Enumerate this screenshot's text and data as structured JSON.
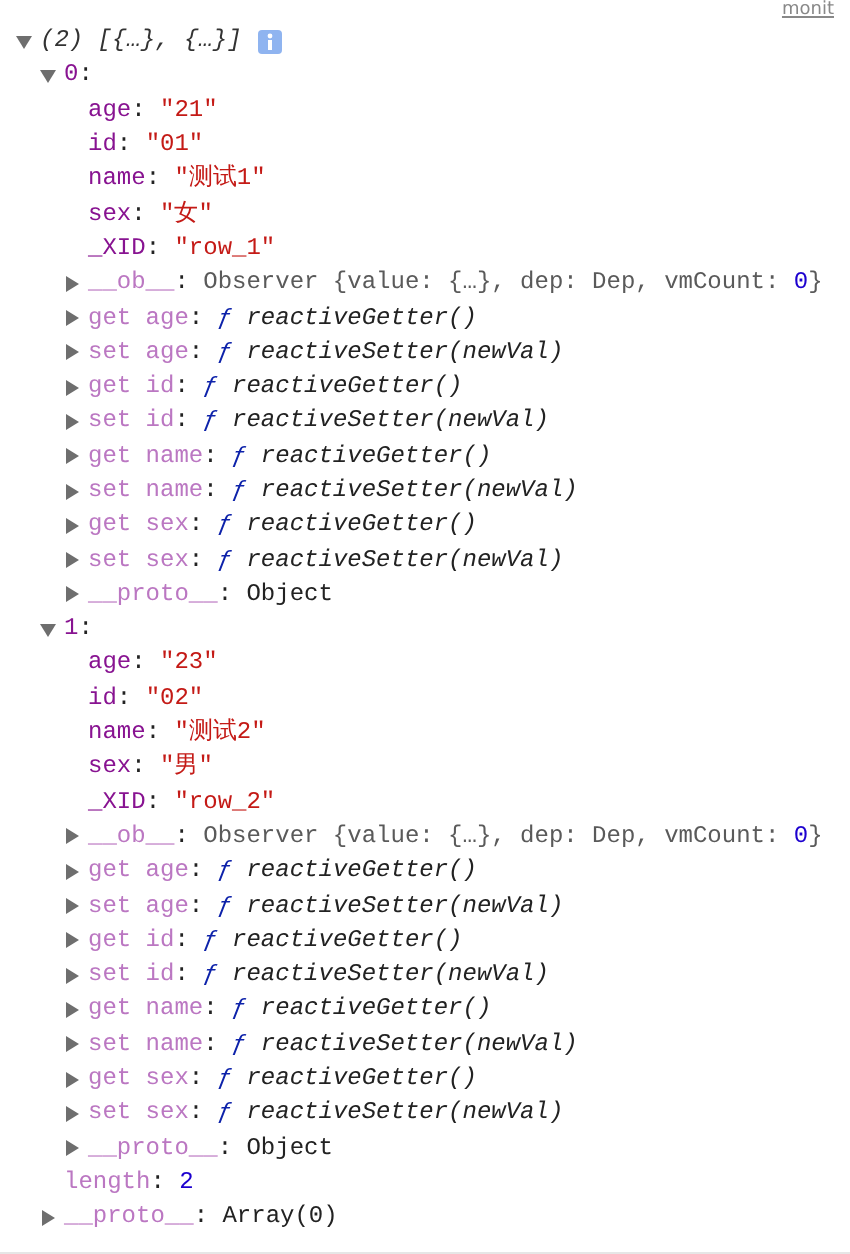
{
  "top_link": "monit",
  "root": {
    "expanded": true,
    "segments": [
      {
        "preview": "(2) [{…}, {…}]"
      }
    ],
    "info_icon": true,
    "children": [
      {
        "expanded": true,
        "segments": [
          {
            "key": "0"
          },
          {
            "plain": ":"
          }
        ],
        "children": [
          {
            "segments": [
              {
                "key": "age"
              },
              {
                "plain": ": "
              },
              {
                "string": "\"21\""
              }
            ]
          },
          {
            "segments": [
              {
                "key": "id"
              },
              {
                "plain": ": "
              },
              {
                "string": "\"01\""
              }
            ]
          },
          {
            "segments": [
              {
                "key": "name"
              },
              {
                "plain": ": "
              },
              {
                "string": "\"测试1\""
              }
            ]
          },
          {
            "segments": [
              {
                "key": "sex"
              },
              {
                "plain": ": "
              },
              {
                "string": "\"女\""
              }
            ]
          },
          {
            "segments": [
              {
                "key": "_XID"
              },
              {
                "plain": ": "
              },
              {
                "string": "\"row_1\""
              }
            ]
          },
          {
            "expanded": false,
            "segments": [
              {
                "dimkey": "__ob__"
              },
              {
                "plain": ": "
              },
              {
                "object": "Observer {value: {…}, dep: Dep, vmCount: "
              },
              {
                "number": "0"
              },
              {
                "object": "}"
              }
            ]
          },
          {
            "expanded": false,
            "segments": [
              {
                "dimkey": "get age"
              },
              {
                "plain": ": "
              },
              {
                "fnmark": "ƒ"
              },
              {
                "fn": " reactiveGetter()"
              }
            ]
          },
          {
            "expanded": false,
            "segments": [
              {
                "dimkey": "set age"
              },
              {
                "plain": ": "
              },
              {
                "fnmark": "ƒ"
              },
              {
                "fn": " reactiveSetter(newVal)"
              }
            ]
          },
          {
            "expanded": false,
            "segments": [
              {
                "dimkey": "get id"
              },
              {
                "plain": ": "
              },
              {
                "fnmark": "ƒ"
              },
              {
                "fn": " reactiveGetter()"
              }
            ]
          },
          {
            "expanded": false,
            "segments": [
              {
                "dimkey": "set id"
              },
              {
                "plain": ": "
              },
              {
                "fnmark": "ƒ"
              },
              {
                "fn": " reactiveSetter(newVal)"
              }
            ]
          },
          {
            "expanded": false,
            "segments": [
              {
                "dimkey": "get name"
              },
              {
                "plain": ": "
              },
              {
                "fnmark": "ƒ"
              },
              {
                "fn": " reactiveGetter()"
              }
            ]
          },
          {
            "expanded": false,
            "segments": [
              {
                "dimkey": "set name"
              },
              {
                "plain": ": "
              },
              {
                "fnmark": "ƒ"
              },
              {
                "fn": " reactiveSetter(newVal)"
              }
            ]
          },
          {
            "expanded": false,
            "segments": [
              {
                "dimkey": "get sex"
              },
              {
                "plain": ": "
              },
              {
                "fnmark": "ƒ"
              },
              {
                "fn": " reactiveGetter()"
              }
            ]
          },
          {
            "expanded": false,
            "segments": [
              {
                "dimkey": "set sex"
              },
              {
                "plain": ": "
              },
              {
                "fnmark": "ƒ"
              },
              {
                "fn": " reactiveSetter(newVal)"
              }
            ]
          },
          {
            "expanded": false,
            "segments": [
              {
                "dimkey": "__proto__"
              },
              {
                "plain": ": "
              },
              {
                "plain": "Object"
              }
            ]
          }
        ]
      },
      {
        "expanded": true,
        "segments": [
          {
            "key": "1"
          },
          {
            "plain": ":"
          }
        ],
        "children": [
          {
            "segments": [
              {
                "key": "age"
              },
              {
                "plain": ": "
              },
              {
                "string": "\"23\""
              }
            ]
          },
          {
            "segments": [
              {
                "key": "id"
              },
              {
                "plain": ": "
              },
              {
                "string": "\"02\""
              }
            ]
          },
          {
            "segments": [
              {
                "key": "name"
              },
              {
                "plain": ": "
              },
              {
                "string": "\"测试2\""
              }
            ]
          },
          {
            "segments": [
              {
                "key": "sex"
              },
              {
                "plain": ": "
              },
              {
                "string": "\"男\""
              }
            ]
          },
          {
            "segments": [
              {
                "key": "_XID"
              },
              {
                "plain": ": "
              },
              {
                "string": "\"row_2\""
              }
            ]
          },
          {
            "expanded": false,
            "segments": [
              {
                "dimkey": "__ob__"
              },
              {
                "plain": ": "
              },
              {
                "object": "Observer {value: {…}, dep: Dep, vmCount: "
              },
              {
                "number": "0"
              },
              {
                "object": "}"
              }
            ]
          },
          {
            "expanded": false,
            "segments": [
              {
                "dimkey": "get age"
              },
              {
                "plain": ": "
              },
              {
                "fnmark": "ƒ"
              },
              {
                "fn": " reactiveGetter()"
              }
            ]
          },
          {
            "expanded": false,
            "segments": [
              {
                "dimkey": "set age"
              },
              {
                "plain": ": "
              },
              {
                "fnmark": "ƒ"
              },
              {
                "fn": " reactiveSetter(newVal)"
              }
            ]
          },
          {
            "expanded": false,
            "segments": [
              {
                "dimkey": "get id"
              },
              {
                "plain": ": "
              },
              {
                "fnmark": "ƒ"
              },
              {
                "fn": " reactiveGetter()"
              }
            ]
          },
          {
            "expanded": false,
            "segments": [
              {
                "dimkey": "set id"
              },
              {
                "plain": ": "
              },
              {
                "fnmark": "ƒ"
              },
              {
                "fn": " reactiveSetter(newVal)"
              }
            ]
          },
          {
            "expanded": false,
            "segments": [
              {
                "dimkey": "get name"
              },
              {
                "plain": ": "
              },
              {
                "fnmark": "ƒ"
              },
              {
                "fn": " reactiveGetter()"
              }
            ]
          },
          {
            "expanded": false,
            "segments": [
              {
                "dimkey": "set name"
              },
              {
                "plain": ": "
              },
              {
                "fnmark": "ƒ"
              },
              {
                "fn": " reactiveSetter(newVal)"
              }
            ]
          },
          {
            "expanded": false,
            "segments": [
              {
                "dimkey": "get sex"
              },
              {
                "plain": ": "
              },
              {
                "fnmark": "ƒ"
              },
              {
                "fn": " reactiveGetter()"
              }
            ]
          },
          {
            "expanded": false,
            "segments": [
              {
                "dimkey": "set sex"
              },
              {
                "plain": ": "
              },
              {
                "fnmark": "ƒ"
              },
              {
                "fn": " reactiveSetter(newVal)"
              }
            ]
          },
          {
            "expanded": false,
            "segments": [
              {
                "dimkey": "__proto__"
              },
              {
                "plain": ": "
              },
              {
                "plain": "Object"
              }
            ]
          }
        ]
      },
      {
        "segments": [
          {
            "dimkey": "length"
          },
          {
            "plain": ": "
          },
          {
            "number": "2"
          }
        ]
      },
      {
        "expanded": false,
        "segments": [
          {
            "dimkey": "__proto__"
          },
          {
            "plain": ": "
          },
          {
            "plain": "Array(0)"
          }
        ]
      }
    ]
  }
}
